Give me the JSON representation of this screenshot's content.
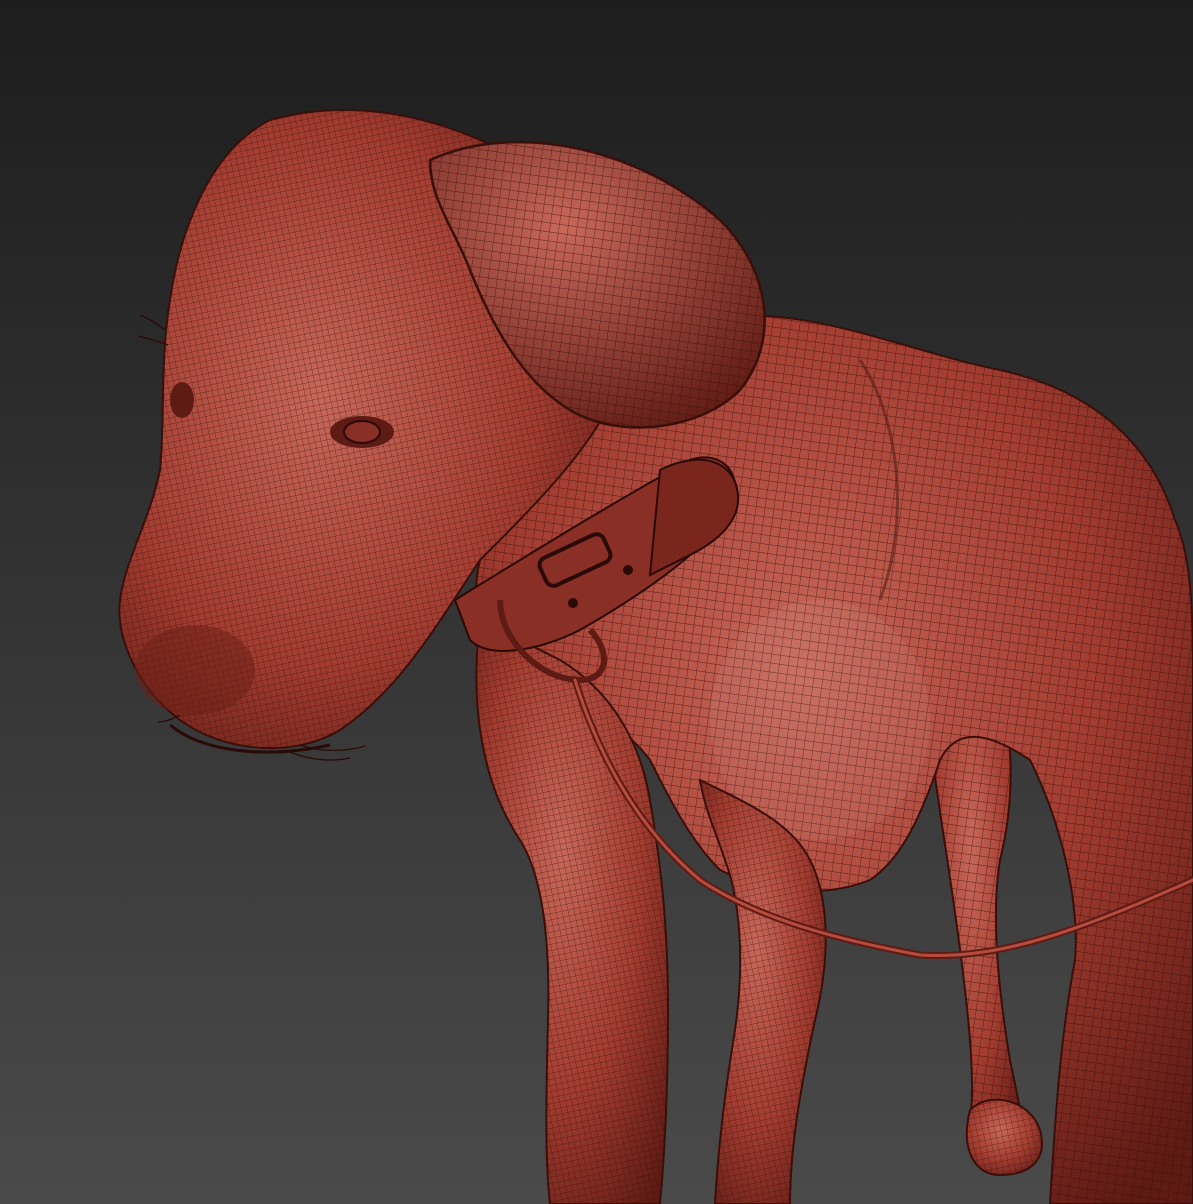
{
  "scene": {
    "subject": "dog-wireframe-sculpt",
    "colors": {
      "background_top": "#1d1d1d",
      "background_bottom": "#4a4a4a",
      "mesh_base": "#a23c30",
      "mesh_light": "#c7685a",
      "mesh_dark": "#5e1b14",
      "wire": "#3a0f0a",
      "collar": "#8a2f25",
      "leash": "#9b3a2e"
    }
  }
}
